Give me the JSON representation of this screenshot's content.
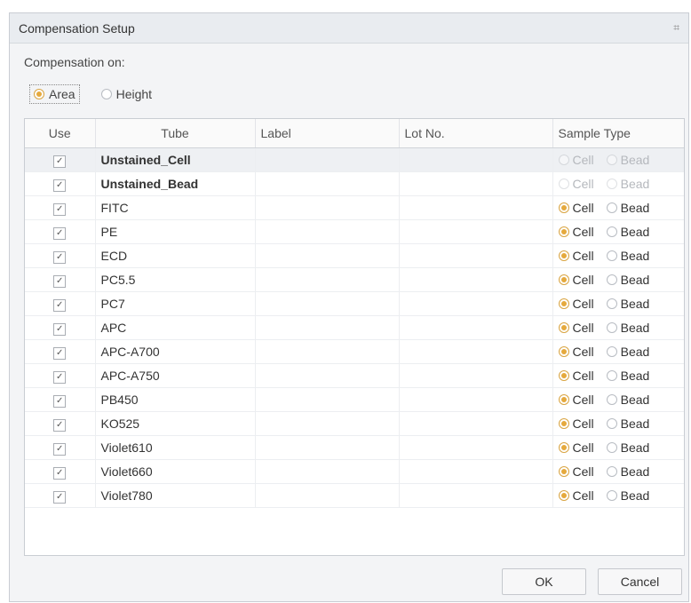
{
  "window": {
    "title": "Compensation Setup",
    "close_glyph": "⌗"
  },
  "compensation": {
    "label": "Compensation on:",
    "options": [
      {
        "label": "Area",
        "selected": true
      },
      {
        "label": "Height",
        "selected": false
      }
    ]
  },
  "table": {
    "headers": {
      "use": "Use",
      "tube": "Tube",
      "label": "Label",
      "lot": "Lot No.",
      "sample_type": "Sample Type"
    },
    "sample_options": {
      "cell": "Cell",
      "bead": "Bead"
    },
    "rows": [
      {
        "use": true,
        "tube": "Unstained_Cell",
        "label": "",
        "lot": "",
        "sample": "none",
        "disabled": true
      },
      {
        "use": true,
        "tube": "Unstained_Bead",
        "label": "",
        "lot": "",
        "sample": "none",
        "disabled": true
      },
      {
        "use": true,
        "tube": "FITC",
        "label": "",
        "lot": "",
        "sample": "Cell",
        "disabled": false
      },
      {
        "use": true,
        "tube": "PE",
        "label": "",
        "lot": "",
        "sample": "Cell",
        "disabled": false
      },
      {
        "use": true,
        "tube": "ECD",
        "label": "",
        "lot": "",
        "sample": "Cell",
        "disabled": false
      },
      {
        "use": true,
        "tube": "PC5.5",
        "label": "",
        "lot": "",
        "sample": "Cell",
        "disabled": false
      },
      {
        "use": true,
        "tube": "PC7",
        "label": "",
        "lot": "",
        "sample": "Cell",
        "disabled": false
      },
      {
        "use": true,
        "tube": "APC",
        "label": "",
        "lot": "",
        "sample": "Cell",
        "disabled": false
      },
      {
        "use": true,
        "tube": "APC-A700",
        "label": "",
        "lot": "",
        "sample": "Cell",
        "disabled": false
      },
      {
        "use": true,
        "tube": "APC-A750",
        "label": "",
        "lot": "",
        "sample": "Cell",
        "disabled": false
      },
      {
        "use": true,
        "tube": "PB450",
        "label": "",
        "lot": "",
        "sample": "Cell",
        "disabled": false
      },
      {
        "use": true,
        "tube": "KO525",
        "label": "",
        "lot": "",
        "sample": "Cell",
        "disabled": false
      },
      {
        "use": true,
        "tube": "Violet610",
        "label": "",
        "lot": "",
        "sample": "Cell",
        "disabled": false
      },
      {
        "use": true,
        "tube": "Violet660",
        "label": "",
        "lot": "",
        "sample": "Cell",
        "disabled": false
      },
      {
        "use": true,
        "tube": "Violet780",
        "label": "",
        "lot": "",
        "sample": "Cell",
        "disabled": false
      }
    ]
  },
  "buttons": {
    "ok": "OK",
    "cancel": "Cancel"
  },
  "colors": {
    "accent_radio": "#e5a93d"
  },
  "icons": {
    "close": "close-icon",
    "checkbox": "checkbox-icon"
  }
}
